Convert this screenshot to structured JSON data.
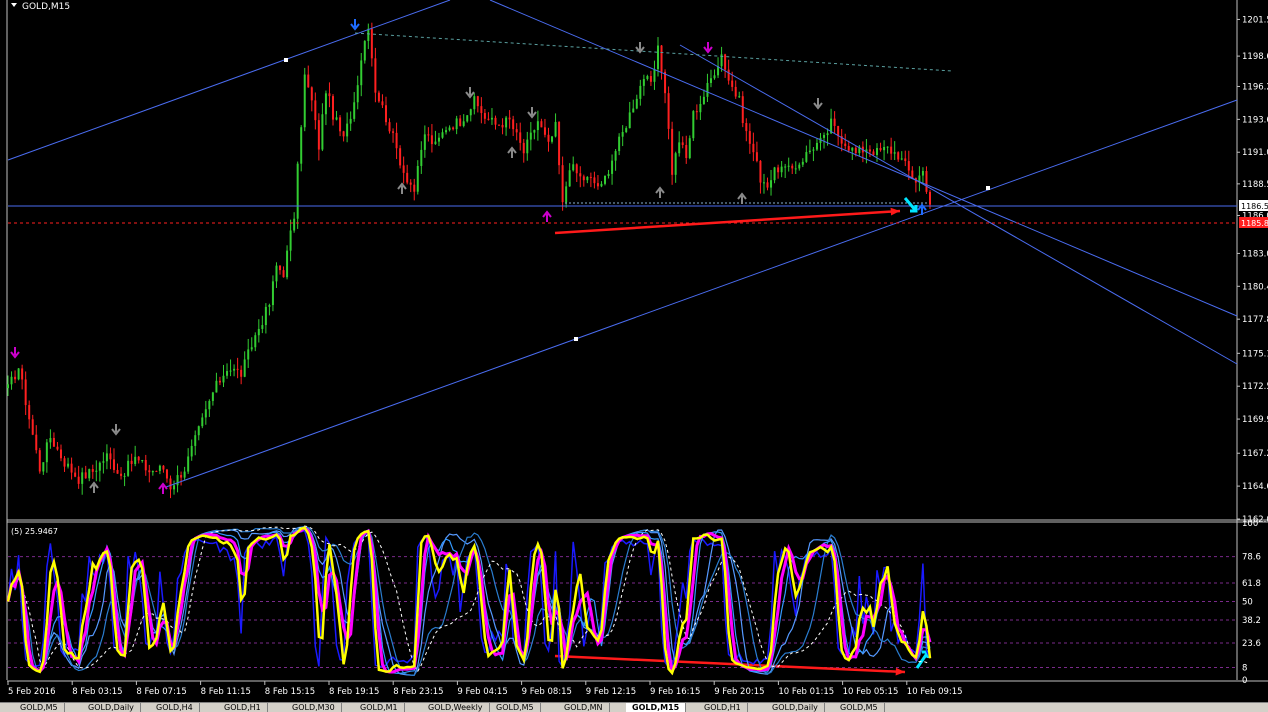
{
  "window": {
    "title": "GOLD,M15",
    "indicator_label": "(5) 25.9467",
    "price_box_upper": "1186.5",
    "price_box_lower": "1185.8"
  },
  "colors": {
    "background": "#000000",
    "bull_candle": "#32cd32",
    "bear_candle": "#ff2020",
    "trendline": "#4a6cf0",
    "divergence_arrow": "#ff1a1a",
    "oscillator_main": "#ffff00",
    "oscillator_signal": "#ff00ff",
    "oscillator_bands": "#3399ff",
    "price_line": "#4a6cf0",
    "bid_line": "#ff2020"
  },
  "price_axis": [
    "1201.5",
    "1198.6",
    "1196.2",
    "1193.6",
    "1191.0",
    "1188.5",
    "1186.0",
    "1183.0",
    "1180.4",
    "1177.8",
    "1175.1",
    "1172.5",
    "1169.9",
    "1167.2",
    "1164.6",
    "1162.0"
  ],
  "indicator_axis": [
    "100",
    "78.6",
    "61.8",
    "50",
    "38.2",
    "23.6",
    "8",
    "0"
  ],
  "time_axis": [
    "5 Feb 2016",
    "8 Feb 03:15",
    "8 Feb 07:15",
    "8 Feb 11:15",
    "8 Feb 15:15",
    "8 Feb 19:15",
    "8 Feb 23:15",
    "9 Feb 04:15",
    "9 Feb 08:15",
    "9 Feb 12:15",
    "9 Feb 16:15",
    "9 Feb 20:15",
    "10 Feb 01:15",
    "10 Feb 05:15",
    "10 Feb 09:15"
  ],
  "tabs": [
    {
      "label": "GOLD,M5",
      "active": false
    },
    {
      "label": "GOLD,Daily",
      "active": false
    },
    {
      "label": "GOLD,H4",
      "active": false
    },
    {
      "label": "GOLD,H1",
      "active": false
    },
    {
      "label": "GOLD,M30",
      "active": false
    },
    {
      "label": "GOLD,M1",
      "active": false
    },
    {
      "label": "GOLD,Weekly",
      "active": false
    },
    {
      "label": "GOLD,M5",
      "active": false
    },
    {
      "label": "GOLD,MN",
      "active": false
    },
    {
      "label": "GOLD,M15",
      "active": true
    },
    {
      "label": "GOLD,H1",
      "active": false
    },
    {
      "label": "GOLD,Daily",
      "active": false
    },
    {
      "label": "GOLD,M5",
      "active": false
    }
  ],
  "chart_data": {
    "type": "candlestick",
    "symbol": "GOLD",
    "timeframe": "M15",
    "ylim": [
      1162.0,
      1202.8
    ],
    "indicator_ylim": [
      0,
      100
    ],
    "close_anchors": [
      [
        0,
        1172.3
      ],
      [
        3,
        1174.0
      ],
      [
        6,
        1170.0
      ],
      [
        9,
        1166.0
      ],
      [
        12,
        1168.5
      ],
      [
        16,
        1166.5
      ],
      [
        20,
        1165.2
      ],
      [
        24,
        1165.8
      ],
      [
        28,
        1167.0
      ],
      [
        32,
        1165.5
      ],
      [
        36,
        1166.8
      ],
      [
        40,
        1165.8
      ],
      [
        44,
        1166.0
      ],
      [
        46,
        1164.6
      ],
      [
        50,
        1166.0
      ],
      [
        54,
        1169.0
      ],
      [
        58,
        1172.0
      ],
      [
        62,
        1174.0
      ],
      [
        66,
        1173.5
      ],
      [
        70,
        1176.5
      ],
      [
        74,
        1179.0
      ],
      [
        76,
        1182.0
      ],
      [
        78,
        1181.5
      ],
      [
        81,
        1186.0
      ],
      [
        84,
        1197.0
      ],
      [
        86,
        1195.0
      ],
      [
        88,
        1191.5
      ],
      [
        90,
        1196.0
      ],
      [
        92,
        1194.0
      ],
      [
        95,
        1192.0
      ],
      [
        98,
        1195.0
      ],
      [
        100,
        1198.5
      ],
      [
        102,
        1201.2
      ],
      [
        104,
        1196.0
      ],
      [
        108,
        1193.0
      ],
      [
        112,
        1189.5
      ],
      [
        115,
        1188.0
      ],
      [
        118,
        1192.5
      ],
      [
        121,
        1191.5
      ],
      [
        124,
        1193.0
      ],
      [
        128,
        1193.5
      ],
      [
        132,
        1195.0
      ],
      [
        135,
        1193.8
      ],
      [
        138,
        1193.2
      ],
      [
        142,
        1193.5
      ],
      [
        146,
        1191.0
      ],
      [
        150,
        1193.5
      ],
      [
        153,
        1191.5
      ],
      [
        155,
        1193.0
      ],
      [
        157,
        1186.8
      ],
      [
        159,
        1190.0
      ],
      [
        162,
        1189.0
      ],
      [
        165,
        1188.8
      ],
      [
        168,
        1188.2
      ],
      [
        171,
        1190.5
      ],
      [
        174,
        1192.5
      ],
      [
        177,
        1194.8
      ],
      [
        180,
        1197.0
      ],
      [
        182,
        1196.2
      ],
      [
        184,
        1199.0
      ],
      [
        186,
        1196.0
      ],
      [
        188,
        1189.5
      ],
      [
        190,
        1192.0
      ],
      [
        192,
        1190.5
      ],
      [
        194,
        1194.0
      ],
      [
        197,
        1195.5
      ],
      [
        200,
        1197.5
      ],
      [
        202,
        1198.8
      ],
      [
        204,
        1196.8
      ],
      [
        207,
        1195.0
      ],
      [
        209,
        1192.5
      ],
      [
        211,
        1191.0
      ],
      [
        213,
        1189.0
      ],
      [
        215,
        1188.5
      ],
      [
        218,
        1189.8
      ],
      [
        221,
        1189.5
      ],
      [
        224,
        1190.2
      ],
      [
        228,
        1191.5
      ],
      [
        231,
        1192.0
      ],
      [
        233,
        1193.3
      ],
      [
        235,
        1192.4
      ],
      [
        237,
        1191.8
      ],
      [
        240,
        1190.9
      ],
      [
        243,
        1191.4
      ],
      [
        246,
        1191.0
      ],
      [
        249,
        1191.3
      ],
      [
        252,
        1190.8
      ],
      [
        255,
        1189.5
      ],
      [
        257,
        1188.8
      ],
      [
        259,
        1189.5
      ],
      [
        261,
        1187.0
      ]
    ],
    "divergence": {
      "price_from": 1184.6,
      "price_to": 1186.0,
      "indicator_from": 18,
      "indicator_to": 8
    }
  }
}
